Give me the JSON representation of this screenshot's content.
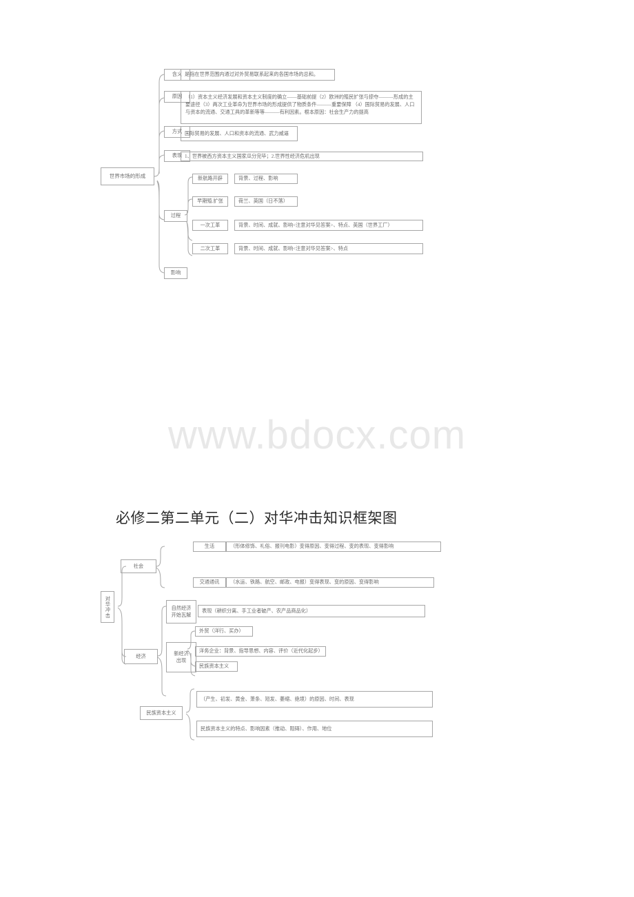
{
  "watermark": {
    "text": "www.bdocx.com"
  },
  "diagram1": {
    "root": {
      "label": "世界市场的形成"
    },
    "branches": [
      {
        "key": "含义",
        "label": "含义",
        "content": "是指在世界范围内通过对外贸易联系起来的各国市场的总和。"
      },
      {
        "key": "原因",
        "label": "原因",
        "content": "（1）资本主义经济发展和资本主义制度的确立——基础前提（2）欧洲的殖民扩张与掠夺———形成的主要途径（3）两次工业革命为世界市场的形成提供了物质条件———重要保障 （4）国际贸易的发展、人口与资本的流通、交通工具的革新等等———有利因素。根本原因：社会生产力的提高"
      },
      {
        "key": "方式",
        "label": "方式",
        "content": "国际贸易的发展、人口和资本的流通、武力威逼"
      },
      {
        "key": "表现",
        "label": "表现",
        "content": "1、世界被西方资本主义国家瓜分完毕；2.世界性经济危机出现"
      },
      {
        "key": "过程",
        "label": "过程",
        "content": ""
      },
      {
        "key": "影响",
        "label": "影响",
        "content": ""
      }
    ],
    "process_items": [
      {
        "label": "新航路开辟",
        "content": "背景、过程、影响"
      },
      {
        "label": "早期殖.扩张",
        "content": "荷兰、英国（日不落）"
      },
      {
        "label": "一次工革",
        "content": "背景、时间、成就、影响<注意对华见答案>、特点、英国（世界工厂）"
      },
      {
        "label": "二次工革",
        "content": "背景、时间、成就、影响<注意对华见答案>、特点"
      }
    ]
  },
  "section2": {
    "title": "必修二第二单元（二）对华冲击知识框架图",
    "root": {
      "label": "对华冲击"
    },
    "society": {
      "label": "社会",
      "items": [
        {
          "label": "生活",
          "content": "（形体修饰、礼俗、报刊电影）变得原因、变得过程、变的表现、变得影响"
        },
        {
          "label": "交通通讯",
          "content": "（水运、铁路、航空、邮政、电报）变得表现、变的原因、变得影响"
        }
      ]
    },
    "economy": {
      "label": "经济",
      "natural": {
        "label": "自然经济\n开始瓦解",
        "content": "表现（耕织分离、手工业者破产、农产品商品化）"
      },
      "new_economy": {
        "label": "新经济\n出现",
        "items": [
          {
            "content": "外贸（洋行、买办）"
          },
          {
            "content": "洋务企业：背景、指导思想、内容、评价（近代化起步）"
          },
          {
            "content": "民族资本主义"
          }
        ]
      }
    },
    "national_capitalism": {
      "label": "民族资本主义",
      "items": [
        {
          "content": "（产生、初发、黄金、萧条、短发、萎缩、绝境）的原因、时间、表现"
        },
        {
          "content": "民族资本主义的特点、影响因素（推动、阻碍）、作用、地位"
        }
      ]
    }
  }
}
